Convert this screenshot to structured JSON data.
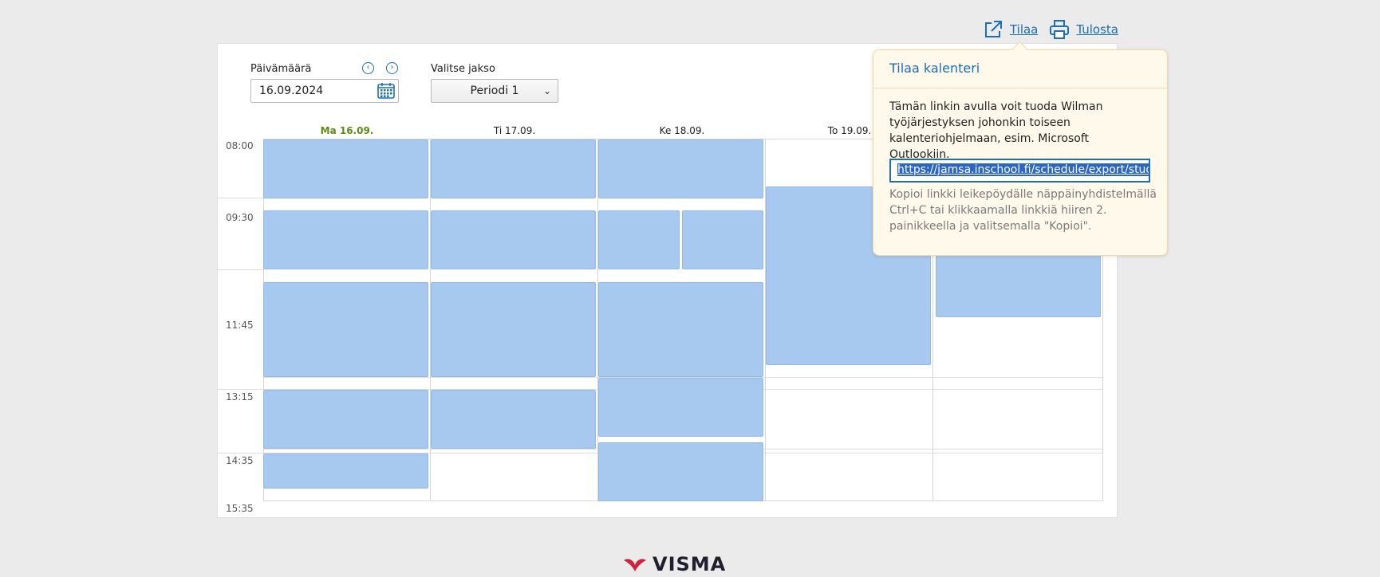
{
  "actions": {
    "subscribe_label": "Tilaa",
    "print_label": "Tulosta"
  },
  "filters": {
    "date_label": "Päivämäärä",
    "date_value": "16.09.2024",
    "period_label": "Valitse jakso",
    "period_value": "Periodi 1"
  },
  "calendar": {
    "days": [
      "Ma 16.09.",
      "Ti 17.09.",
      "Ke 18.09.",
      "To 19.09."
    ],
    "times": [
      "08:00",
      "09:30",
      "11:45",
      "13:15",
      "14:35",
      "15:35"
    ]
  },
  "popup": {
    "title": "Tilaa kalenteri",
    "description": "Tämän linkin avulla voit tuoda Wilman työjärjestyksen johonkin toiseen kalenteriohjelmaan, esim. Microsoft Outlookiin.",
    "url": "https://jamsa.inschool.fi/schedule/export/stude",
    "hint": "Kopioi linkki leikepöydälle näppäinyhdistelmällä Ctrl+C tai klikkaamalla linkkiä hiiren 2. painikkeella ja valitsemalla \"Kopioi\"."
  },
  "footer": {
    "brand": "VISMA"
  },
  "colors": {
    "accent": "#1a6fb5",
    "today": "#5c8a14",
    "event": "#a8c9ef",
    "popup_bg": "#fff9ec"
  }
}
